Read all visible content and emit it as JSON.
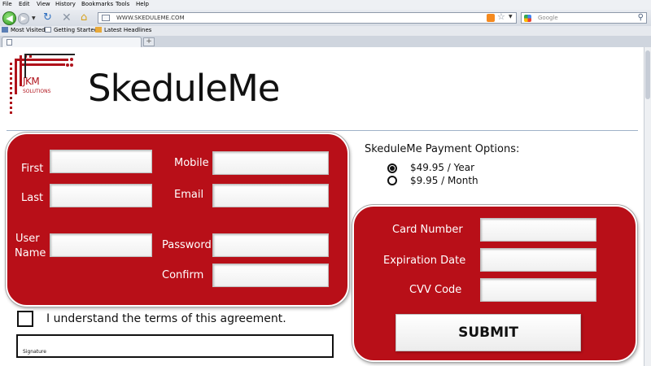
{
  "browser": {
    "menu": [
      "File",
      "Edit",
      "View",
      "History",
      "Bookmarks",
      "Tools",
      "Help"
    ],
    "url": "WWW.SKEDULEME.COM",
    "search_placeholder": "Google",
    "bookmarks": [
      "Most Visited",
      "Getting Started",
      "Latest Headlines"
    ],
    "new_tab_label": "+"
  },
  "logo": {
    "main": "JKM",
    "sub": "SOLUTIONS"
  },
  "app_title": "SkeduleMe",
  "form": {
    "first_label": "First",
    "last_label": "Last",
    "mobile_label": "Mobile",
    "email_label": "Email",
    "user_name_label_1": "User",
    "user_name_label_2": "Name",
    "password_label": "Password",
    "confirm_label": "Confirm"
  },
  "payment": {
    "title": "SkeduleMe Payment Options:",
    "options": [
      {
        "label": "$49.95 / Year",
        "selected": true
      },
      {
        "label": "$9.95 / Month",
        "selected": false
      }
    ],
    "card_number_label": "Card Number",
    "expiration_label": "Expiration Date",
    "cvv_label": "CVV Code",
    "submit_label": "SUBMIT"
  },
  "terms_text": "I understand the terms of this agreement.",
  "signature_label": "Signature",
  "colors": {
    "accent": "#b80f18"
  }
}
